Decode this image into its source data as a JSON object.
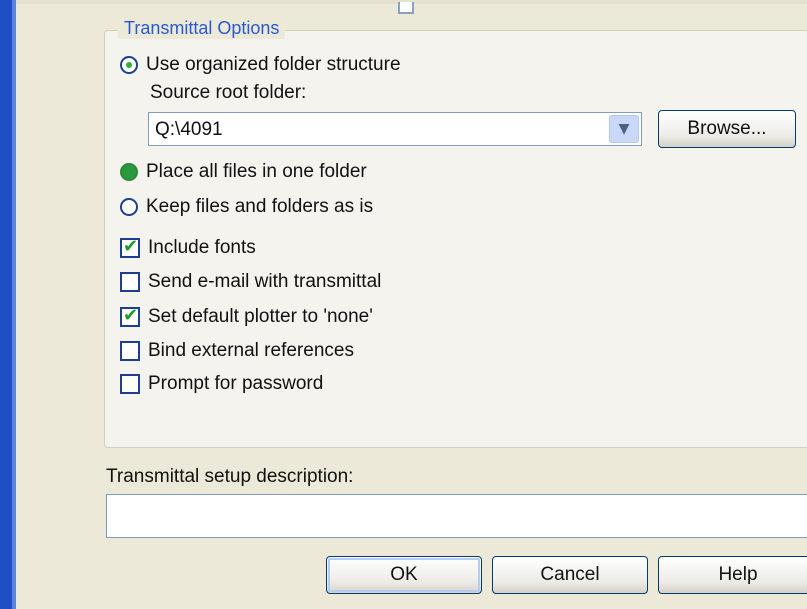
{
  "group": {
    "legend": "Transmittal Options"
  },
  "options": {
    "organized": {
      "label": "Use organized folder structure",
      "selected": true
    },
    "source_root_label": "Source root folder:",
    "source_root_value": "Q:\\4091",
    "browse_label": "Browse...",
    "one_folder": {
      "label": "Place all files in one folder",
      "selected": true
    },
    "keep_as_is": {
      "label": "Keep files and folders as is",
      "selected": false
    }
  },
  "checkboxes": [
    {
      "label": "Include fonts",
      "checked": true
    },
    {
      "label": "Send e-mail with transmittal",
      "checked": false
    },
    {
      "label": "Set default plotter to 'none'",
      "checked": true
    },
    {
      "label": "Bind external references",
      "checked": false
    },
    {
      "label": "Prompt for password",
      "checked": false
    }
  ],
  "description": {
    "label": "Transmittal setup description:",
    "value": ""
  },
  "buttons": {
    "ok": "OK",
    "cancel": "Cancel",
    "help": "Help"
  },
  "colors": {
    "accent": "#2a5ad0",
    "window_border": "#1f4fc6",
    "check_green": "#1e9a2a"
  }
}
